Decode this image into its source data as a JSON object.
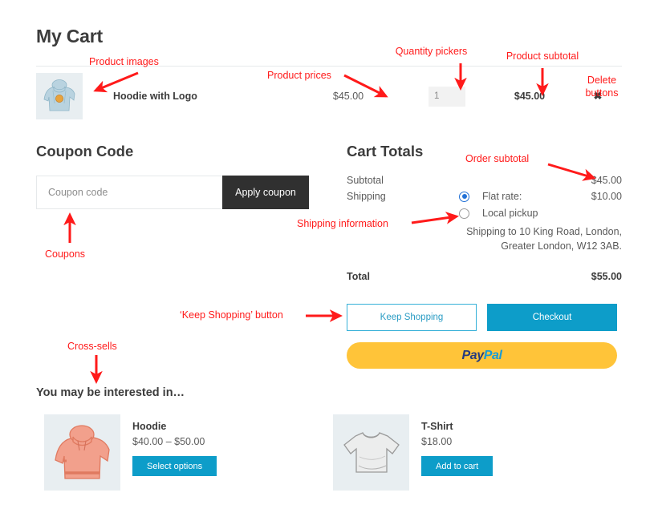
{
  "page": {
    "title": "My Cart"
  },
  "cart": {
    "rows": [
      {
        "thumb_icon": "hoodie-with-logo-thumbnail",
        "name": "Hoodie with Logo",
        "price": "$45.00",
        "quantity": "1",
        "subtotal": "$45.00",
        "remove_label": "✖"
      }
    ]
  },
  "coupon": {
    "heading": "Coupon Code",
    "placeholder": "Coupon code",
    "value": "",
    "apply_label": "Apply coupon"
  },
  "totals": {
    "heading": "Cart Totals",
    "subtotal_label": "Subtotal",
    "subtotal_value": "$45.00",
    "shipping_label": "Shipping",
    "shipping_options": [
      {
        "label": "Flat rate:",
        "cost": "$10.00",
        "selected": true
      },
      {
        "label": "Local pickup",
        "cost": "",
        "selected": false
      }
    ],
    "shipping_address": "Shipping to 10 King Road, London, Greater London, W12 3AB.",
    "total_label": "Total",
    "total_value": "$55.00"
  },
  "actions": {
    "keep_shopping_label": "Keep Shopping",
    "checkout_label": "Checkout",
    "paypal_label_dark": "Pay",
    "paypal_label_light": "Pal"
  },
  "cross_sells": {
    "heading": "You may be interested in…",
    "items": [
      {
        "thumb_icon": "hoodie-thumbnail",
        "name": "Hoodie",
        "price": "$40.00 – $50.00",
        "button_label": "Select options"
      },
      {
        "thumb_icon": "tshirt-thumbnail",
        "name": "T-Shirt",
        "price": "$18.00",
        "button_label": "Add to cart"
      }
    ]
  },
  "annotations": {
    "color": "#ff1a1a",
    "items": [
      {
        "id": "product-images",
        "text": "Product images"
      },
      {
        "id": "product-prices",
        "text": "Product prices"
      },
      {
        "id": "quantity-pickers",
        "text": "Quantity pickers"
      },
      {
        "id": "product-subtotal",
        "text": "Product subtotal"
      },
      {
        "id": "delete-buttons",
        "text": "Delete\nbuttons"
      },
      {
        "id": "order-subtotal",
        "text": "Order subtotal"
      },
      {
        "id": "shipping-information",
        "text": "Shipping information"
      },
      {
        "id": "coupons",
        "text": "Coupons"
      },
      {
        "id": "keep-shopping",
        "text": "‘Keep Shopping’ button"
      },
      {
        "id": "cross-sells",
        "text": "Cross-sells"
      }
    ]
  },
  "colors": {
    "accent_blue": "#0d9dc9",
    "keep_shopping_border": "#35b0d8",
    "coupon_button": "#303030",
    "paypal_yellow": "#ffc439",
    "paypal_dark": "#253b80",
    "paypal_light": "#179bd7",
    "radio_selected": "#2271d6",
    "thumb_background": "#e8eef1",
    "annotation_red": "#ff1a1a"
  }
}
